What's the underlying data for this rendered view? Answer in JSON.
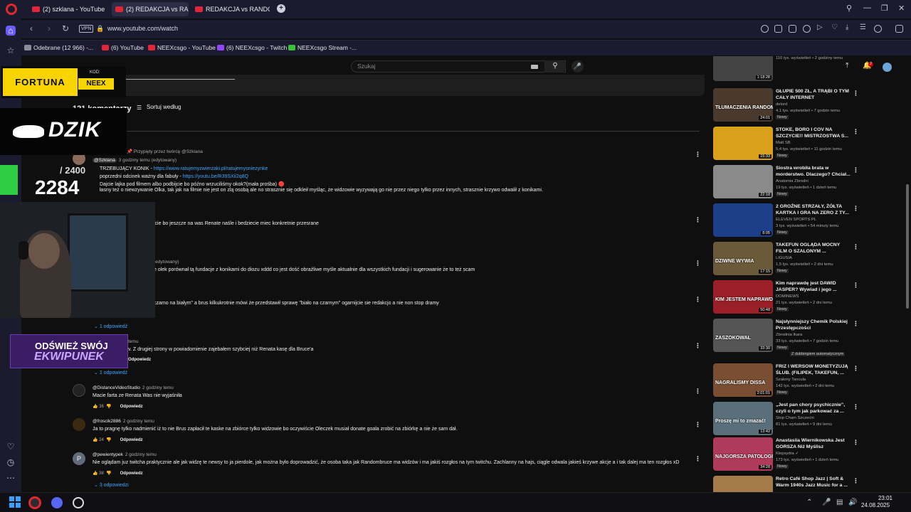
{
  "browser": {
    "tabs": [
      {
        "label": "(2) szklana - YouTube",
        "active": false
      },
      {
        "label": "(2) REDAKCJA vs RANDOMBRUCE",
        "active": true
      },
      {
        "label": "REDAKCJA vs RANDOMBRUCE",
        "active": false
      }
    ],
    "vpn_label": "VPN",
    "url": "www.youtube.com/watch",
    "bookmarks": [
      {
        "label": "Odebrane (12 966) -..."
      },
      {
        "label": "(6) YouTube"
      },
      {
        "label": "NEEXcsgo - YouTube"
      },
      {
        "label": "(6) NEEXcsgo - Twitch"
      },
      {
        "label": "NEEXcsgo Stream -..."
      }
    ]
  },
  "youtube": {
    "search_placeholder": "Szukaj",
    "notifications_count": "2",
    "comments_count": "121 komentarzy",
    "sort_label": "Sortuj według",
    "comments": [
      {
        "pinned_by": "twórcę @Szklana",
        "author": "@Szklana",
        "time": "3 godziny temu (edytowany)",
        "line1_text": "TRZEBUJĄCY KONIK - ",
        "line1_link": "https://www.ratujemyzwierzaki.pl/ratujemysniezynke",
        "line2_text": "poprzedni odcinek ważny dla fabuły - ",
        "line2_link": "https://youtu.be/R39SXii2q8Q",
        "line3_text": "Dajcie lajka pod filmem albo podbijcie bo późno wrzuciliśmy okok?(mała prośba) 🔴",
        "line4_text": "łasny też o niewzywanie Olka, tak jak na filmie nie jest on zlą osobą ale no strasznie się odkleił myśląc, że widzowie wyzywają go nie przez niego tylko przez innych, strasznie krzywo odwalił z konikami."
      },
      {
        "text": "jcie bo jeszcze na was Renate naśle i bedziecie miec konkretnie przesrane"
      },
      {
        "time": "(edytowany)",
        "text": "e olek porównał tą fundacje z konikami do diozu xddd co jest dość obraźliwe myśle aktualnie dla wszystkich fundacji i sugerowanie że to też scam"
      },
      {
        "text": "czamo na białym\" a brus kilkukrotnie mówi że przedstawił sprawę \"biało na czarnym\" ogarnijcie sie redakcjo a nie non stop dramy",
        "replies": "1 odpowiedź"
      },
      {
        "time": "temu",
        "text": "v. Z drugiej strony w powiadomienie zajebałem szybciej niż Renata kasę dla Bruce'a",
        "reply": "Odpowiedz",
        "replies": "1 odpowiedź"
      },
      {
        "author": "@DistanceVideoStudio",
        "time": "2 godziny temu",
        "text": "Macie farta ze Renata Was nie wyjaśniła",
        "likes": "36",
        "reply": "Odpowiedz"
      },
      {
        "author": "@froscik2886",
        "time": "2 godziny temu",
        "text": "Ja to pragnę tylko nadmienić iż to nie Brus zapłacił te kaske na zbiórce tylko widzowie bo oczywiście Oleczek musiał donate goala zrobić na zbiórkę a nie że sam dał.",
        "likes": "24",
        "reply": "Odpowiedz"
      },
      {
        "author": "@pewientypek",
        "avatar_letter": "P",
        "time": "2 godziny temu",
        "text": "Nie oglądam juz twitcha praktycznie ale jak widzę te newsy to ja pierdole, jak można było doprowadzić, że osoba taka jak Randombruce ma widzów i ma jakiś rozgłos na tym twitchu. Zachlanny na hajs, ciągle odwala jakieś krzywe akcje a i tak dalej ma ten rozgłos xD",
        "likes": "38",
        "reply": "Odpowiedz",
        "replies": "3 odpowiedzi"
      }
    ],
    "top_meta": "110 tys. wyświetleń • 2 godziny temu",
    "top_duration": "1:18:28",
    "recommended": [
      {
        "title": "GŁUPIE 500 ZŁ, A TRĄBI O TYM CAŁY INTERNET",
        "channel": "delord",
        "meta": "4,1 tys. wyświetleń • 7 godzin temu",
        "badge": "Nowy",
        "duration": "24:01",
        "caption": "TŁUMACZENIA RANDOMBRUCE'A",
        "color": "#4a3a2e"
      },
      {
        "title": "STOKE, BORO I COV NA SZCZYCIE!! MISTRZOSTWA S...",
        "channel": "Matt SB",
        "meta": "5,4 tys. wyświetleń • 11 godzin temu",
        "badge": "Nowy",
        "duration": "15:33",
        "caption": "",
        "color": "#d9a01c"
      },
      {
        "title": "Siostra wrobiła brata w morderstwo. Dlaczego? Chciał...",
        "channel": "Anatomia Zbrodni",
        "meta": "19 tys. wyświetleń • 1 dzień temu",
        "badge": "Nowy",
        "duration": "22:18",
        "caption": "",
        "color": "#8a8a8a"
      },
      {
        "title": "2 GROŹNE STRZAŁY, ŻÓŁTA KARTKA I GRA NA ZERO Z TY...",
        "channel": "ELEVEN SPORTS PL",
        "meta": "3 tys. wyświetleń • 54 minuty temu",
        "badge": "Nowy",
        "duration": "8:05",
        "caption": "",
        "color": "#1d3f8a"
      },
      {
        "title": "TAKEFUN OGLĄDA MOCNY FILM O SZALONYM ...",
        "channel": "LIGUSIA",
        "meta": "1,5 tys. wyświetleń • 2 dni temu",
        "badge": "Nowy",
        "duration": "17:15",
        "caption": "DZIWNE WYWIA",
        "color": "#6a5a3a"
      },
      {
        "title": "Kim naprawdę jest DAWID JASPER? Wywiad i jego ...",
        "channel": "DOMINEWS",
        "meta": "21 tys. wyświetleń • 2 dni temu",
        "badge": "Nowy",
        "duration": "50:48",
        "caption": "KIM JESTEM NAPRAWDĘ?",
        "color": "#9b1f26"
      },
      {
        "title": "Najsłynniejszy Chemik Polskiej Przestępczości",
        "channel": "Zbrodnia Ikara",
        "meta": "33 tys. wyświetleń • 7 godzin temu",
        "badge": "Nowy",
        "badge2": "Z dubbingiem automatycznym",
        "duration": "33:30",
        "caption": "ZASZOKOWAŁ",
        "color": "#555"
      },
      {
        "title": "FRIZ I WERSOW MONETYZUJĄ ŚLUB. (FILIPEK, TAKEFUN, ...",
        "channel": "Szalony Tancula",
        "meta": "142 tys. wyświetleń • 2 dni temu",
        "badge": "Nowy",
        "duration": "2:01:01",
        "caption": "NAGRALISMY DISSA",
        "color": "#7a4e33"
      },
      {
        "title": "„Jest pan chory psychicznie”, czyli o tym jak parkować za ...",
        "channel": "Stop Cham Szczecin",
        "meta": "81 tys. wyświetleń • 9 dni temu",
        "badge": "",
        "duration": "13:42",
        "caption": "Proszę mi to zmazać!",
        "color": "#5a6f7a"
      },
      {
        "title": "Anastasiia Wiernikowska Jest GORSZA Niż Myślisz",
        "channel": "Klepsydra ✓",
        "meta": "173 tys. wyświetleń • 1 dzień temu",
        "badge": "Nowy",
        "duration": "34:28",
        "caption": "NAJGORSZA PATOLOGICZNA INFLUENCERKA",
        "color": "#b03a5a"
      },
      {
        "title": "Retro Café Shop Jazz | Soft & Warm 1940s Jazz Music for a ...",
        "channel": "",
        "meta": "",
        "badge": "",
        "duration": "",
        "caption": "",
        "color": "#a57b4a"
      }
    ]
  },
  "overlay": {
    "fortuna": "FORTUNA",
    "kod_label": "KOD:",
    "kod_value": "NEEX",
    "dzik": "DZIK",
    "counter_max": "/ 2400",
    "counter_current": "2284",
    "equip_line1": "ODŚWIEŻ SWÓJ",
    "equip_line2": "EKWIPUNEK"
  },
  "taskbar": {
    "time": "23:01",
    "date": "24.08.2025"
  },
  "colors": {
    "accent": "#3ea6ff",
    "opera_red": "#e0262e",
    "fortuna_yellow": "#f7d400"
  }
}
